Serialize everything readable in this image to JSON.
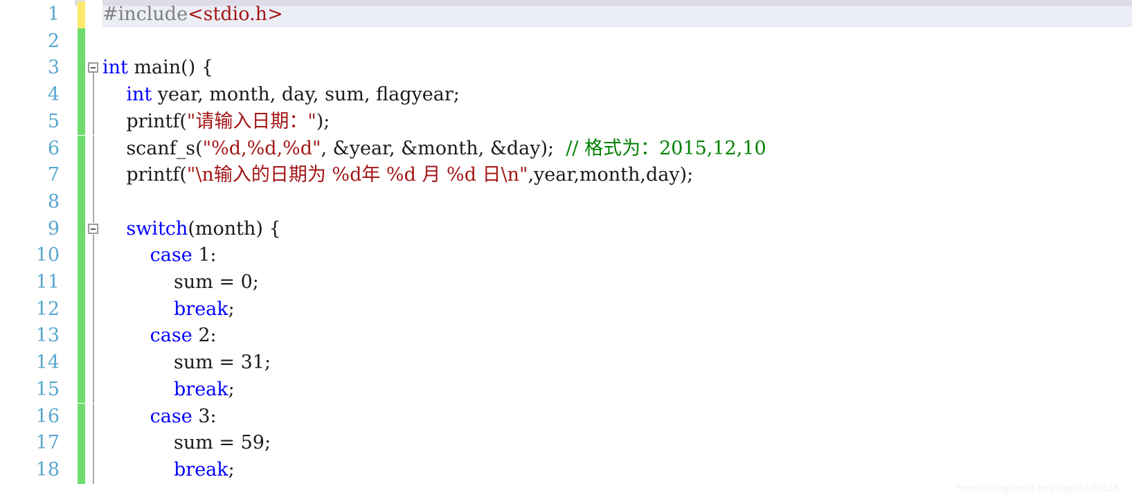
{
  "editor": {
    "language": "C",
    "colors": {
      "keyword": "#0000ff",
      "string": "#a31515",
      "comment": "#008000",
      "preprocessor": "#808080",
      "plain": "#1a1a1a",
      "line_number": "#58a6cf",
      "change_bar_modified": "#fbe96b",
      "change_bar_added": "#6ddc6d",
      "current_line_highlight": "#eceef5",
      "background": "#ffffff"
    },
    "caret": {
      "line": 1,
      "column": 18
    },
    "current_line": 1,
    "lines": [
      {
        "number": "1",
        "change": "modified",
        "fold": "none",
        "tokens": [
          {
            "text": "#include",
            "type": "preprocessor"
          },
          {
            "text": "<stdio.h>",
            "type": "string"
          }
        ]
      },
      {
        "number": "2",
        "change": "added",
        "fold": "none",
        "tokens": []
      },
      {
        "number": "3",
        "change": "added",
        "fold": "marker-start",
        "tokens": [
          {
            "text": "int",
            "type": "keyword"
          },
          {
            "text": " main() {",
            "type": "plain"
          }
        ]
      },
      {
        "number": "4",
        "change": "added",
        "fold": "guide",
        "tokens": [
          {
            "text": "    ",
            "type": "plain"
          },
          {
            "text": "int",
            "type": "keyword"
          },
          {
            "text": " year, month, day, sum, flagyear;",
            "type": "plain"
          }
        ]
      },
      {
        "number": "5",
        "change": "added",
        "fold": "guide",
        "tokens": [
          {
            "text": "    printf(",
            "type": "plain"
          },
          {
            "text": "\"请输入日期：\"",
            "type": "string"
          },
          {
            "text": ");",
            "type": "plain"
          }
        ]
      },
      {
        "number": "6",
        "change": "added",
        "fold": "guide",
        "tokens": [
          {
            "text": "    scanf_s(",
            "type": "plain"
          },
          {
            "text": "\"%d,%d,%d\"",
            "type": "string"
          },
          {
            "text": ", &year, &month, &day);  ",
            "type": "plain"
          },
          {
            "text": "// 格式为：2015,12,10",
            "type": "comment"
          }
        ]
      },
      {
        "number": "7",
        "change": "added",
        "fold": "guide",
        "tokens": [
          {
            "text": "    printf(",
            "type": "plain"
          },
          {
            "text": "\"\\n输入的日期为 %d年 %d 月 %d 日\\n\"",
            "type": "string"
          },
          {
            "text": ",year,month,day);",
            "type": "plain"
          }
        ]
      },
      {
        "number": "8",
        "change": "added",
        "fold": "guide",
        "tokens": []
      },
      {
        "number": "9",
        "change": "added",
        "fold": "marker-nested",
        "tokens": [
          {
            "text": "    ",
            "type": "plain"
          },
          {
            "text": "switch",
            "type": "keyword"
          },
          {
            "text": "(month) {",
            "type": "plain"
          }
        ]
      },
      {
        "number": "10",
        "change": "added",
        "fold": "guide",
        "tokens": [
          {
            "text": "        ",
            "type": "plain"
          },
          {
            "text": "case",
            "type": "keyword"
          },
          {
            "text": " 1:",
            "type": "plain"
          }
        ]
      },
      {
        "number": "11",
        "change": "added",
        "fold": "guide",
        "tokens": [
          {
            "text": "            sum = 0;",
            "type": "plain"
          }
        ]
      },
      {
        "number": "12",
        "change": "added",
        "fold": "guide",
        "tokens": [
          {
            "text": "            ",
            "type": "plain"
          },
          {
            "text": "break",
            "type": "keyword"
          },
          {
            "text": ";",
            "type": "plain"
          }
        ]
      },
      {
        "number": "13",
        "change": "added",
        "fold": "guide",
        "tokens": [
          {
            "text": "        ",
            "type": "plain"
          },
          {
            "text": "case",
            "type": "keyword"
          },
          {
            "text": " 2:",
            "type": "plain"
          }
        ]
      },
      {
        "number": "14",
        "change": "added",
        "fold": "guide",
        "tokens": [
          {
            "text": "            sum = 31;",
            "type": "plain"
          }
        ]
      },
      {
        "number": "15",
        "change": "added",
        "fold": "guide",
        "tokens": [
          {
            "text": "            ",
            "type": "plain"
          },
          {
            "text": "break",
            "type": "keyword"
          },
          {
            "text": ";",
            "type": "plain"
          }
        ]
      },
      {
        "number": "16",
        "change": "added",
        "fold": "guide",
        "tokens": [
          {
            "text": "        ",
            "type": "plain"
          },
          {
            "text": "case",
            "type": "keyword"
          },
          {
            "text": " 3:",
            "type": "plain"
          }
        ]
      },
      {
        "number": "17",
        "change": "added",
        "fold": "guide",
        "tokens": [
          {
            "text": "            sum = 59;",
            "type": "plain"
          }
        ]
      },
      {
        "number": "18",
        "change": "added",
        "fold": "guide",
        "tokens": [
          {
            "text": "            ",
            "type": "plain"
          },
          {
            "text": "break",
            "type": "keyword"
          },
          {
            "text": ";",
            "type": "plain"
          }
        ]
      }
    ]
  },
  "watermark": {
    "text": "https://blog.csdn.net/ling08140814"
  }
}
